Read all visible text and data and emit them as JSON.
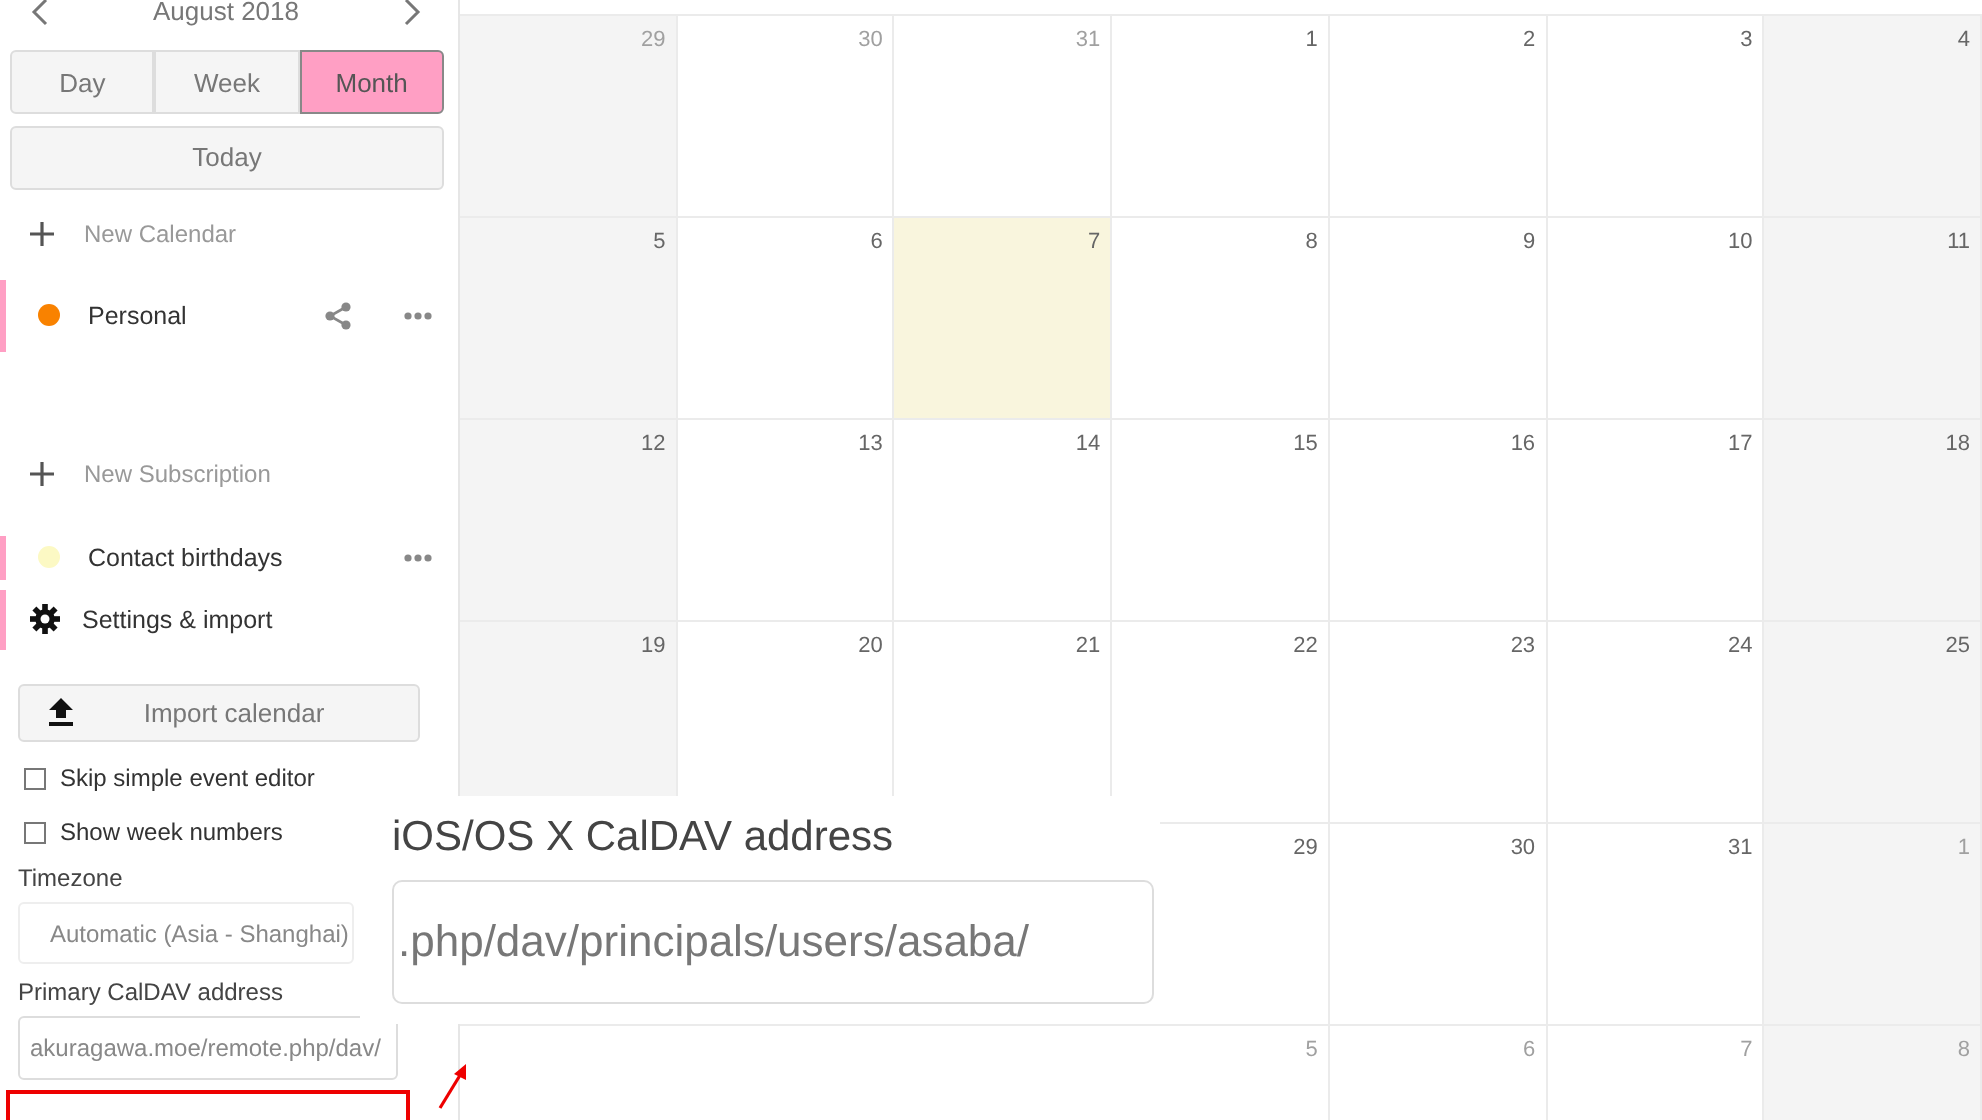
{
  "sidebar": {
    "month_nav": {
      "title": "August 2018"
    },
    "views": [
      {
        "label": "Day",
        "selected": false
      },
      {
        "label": "Week",
        "selected": false
      },
      {
        "label": "Month",
        "selected": true
      }
    ],
    "today_button": "Today",
    "new_calendar": "New Calendar",
    "calendars": [
      {
        "name": "Personal",
        "color": "#f98200",
        "shareable": true,
        "highlighted": true
      }
    ],
    "new_subscription": "New Subscription",
    "subscriptions": [
      {
        "name": "Contact birthdays",
        "color": "#fcf9c4",
        "shareable": false,
        "highlighted": true
      }
    ],
    "settings": {
      "title": "Settings & import",
      "import_button": "Import calendar",
      "options": [
        {
          "label": "Skip simple event editor",
          "checked": false
        },
        {
          "label": "Show week numbers",
          "checked": false
        }
      ],
      "timezone_label": "Timezone",
      "timezone_value": "Automatic (Asia - Shanghai)",
      "caldav_label": "Primary CalDAV address",
      "caldav_value": "akuragawa.moe/remote.php/dav/"
    }
  },
  "calendar": {
    "weeks": [
      {
        "days": [
          {
            "label": "29",
            "muted": true,
            "today": false
          },
          {
            "label": "30",
            "muted": true,
            "today": false
          },
          {
            "label": "31",
            "muted": true,
            "today": false
          },
          {
            "label": "1",
            "muted": false,
            "today": false
          },
          {
            "label": "2",
            "muted": false,
            "today": false
          },
          {
            "label": "3",
            "muted": false,
            "today": false
          },
          {
            "label": "4",
            "muted": false,
            "today": false
          }
        ]
      },
      {
        "days": [
          {
            "label": "5",
            "muted": false,
            "today": false
          },
          {
            "label": "6",
            "muted": false,
            "today": false
          },
          {
            "label": "7",
            "muted": false,
            "today": true
          },
          {
            "label": "8",
            "muted": false,
            "today": false
          },
          {
            "label": "9",
            "muted": false,
            "today": false
          },
          {
            "label": "10",
            "muted": false,
            "today": false
          },
          {
            "label": "11",
            "muted": false,
            "today": false
          }
        ]
      },
      {
        "days": [
          {
            "label": "12",
            "muted": false,
            "today": false
          },
          {
            "label": "13",
            "muted": false,
            "today": false
          },
          {
            "label": "14",
            "muted": false,
            "today": false
          },
          {
            "label": "15",
            "muted": false,
            "today": false
          },
          {
            "label": "16",
            "muted": false,
            "today": false
          },
          {
            "label": "17",
            "muted": false,
            "today": false
          },
          {
            "label": "18",
            "muted": false,
            "today": false
          }
        ]
      },
      {
        "days": [
          {
            "label": "19",
            "muted": false,
            "today": false
          },
          {
            "label": "20",
            "muted": false,
            "today": false
          },
          {
            "label": "21",
            "muted": false,
            "today": false
          },
          {
            "label": "22",
            "muted": false,
            "today": false
          },
          {
            "label": "23",
            "muted": false,
            "today": false
          },
          {
            "label": "24",
            "muted": false,
            "today": false
          },
          {
            "label": "25",
            "muted": false,
            "today": false
          }
        ]
      },
      {
        "days": [
          {
            "label": "29",
            "muted": false,
            "today": false
          },
          {
            "label": "30",
            "muted": false,
            "today": false
          },
          {
            "label": "31",
            "muted": false,
            "today": false
          },
          {
            "label": "1",
            "muted": true,
            "today": false
          }
        ]
      },
      {
        "days": [
          {
            "label": "5",
            "muted": true,
            "today": false
          },
          {
            "label": "6",
            "muted": true,
            "today": false
          },
          {
            "label": "7",
            "muted": true,
            "today": false
          },
          {
            "label": "8",
            "muted": true,
            "today": false
          }
        ]
      }
    ]
  },
  "zoom_callout": {
    "label": "iOS/OS X CalDAV address",
    "value": ".php/dav/principals/users/asaba/"
  }
}
